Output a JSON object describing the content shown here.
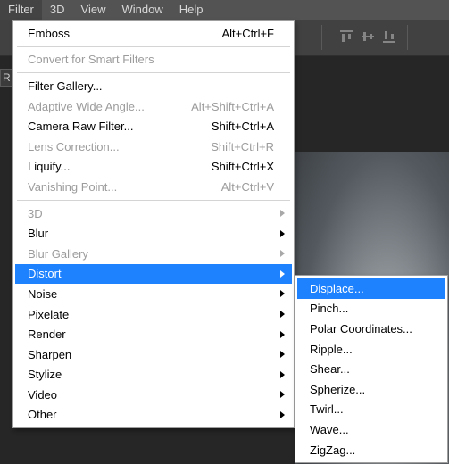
{
  "menubar": {
    "items": [
      "Filter",
      "3D",
      "View",
      "Window",
      "Help"
    ],
    "active_index": 0
  },
  "bg_tab_letter": "R",
  "filter_menu": {
    "last_used": {
      "label": "Emboss",
      "shortcut": "Alt+Ctrl+F"
    },
    "convert": {
      "label": "Convert for Smart Filters"
    },
    "gallery": {
      "label": "Filter Gallery..."
    },
    "adaptive": {
      "label": "Adaptive Wide Angle...",
      "shortcut": "Alt+Shift+Ctrl+A"
    },
    "camera_raw": {
      "label": "Camera Raw Filter...",
      "shortcut": "Shift+Ctrl+A"
    },
    "lens": {
      "label": "Lens Correction...",
      "shortcut": "Shift+Ctrl+R"
    },
    "liquify": {
      "label": "Liquify...",
      "shortcut": "Shift+Ctrl+X"
    },
    "vanishing": {
      "label": "Vanishing Point...",
      "shortcut": "Alt+Ctrl+V"
    },
    "sub3d": {
      "label": "3D"
    },
    "blur": {
      "label": "Blur"
    },
    "blur_gallery": {
      "label": "Blur Gallery"
    },
    "distort": {
      "label": "Distort"
    },
    "noise": {
      "label": "Noise"
    },
    "pixelate": {
      "label": "Pixelate"
    },
    "render": {
      "label": "Render"
    },
    "sharpen": {
      "label": "Sharpen"
    },
    "stylize": {
      "label": "Stylize"
    },
    "video": {
      "label": "Video"
    },
    "other": {
      "label": "Other"
    }
  },
  "distort_submenu": {
    "displace": "Displace...",
    "pinch": "Pinch...",
    "polar": "Polar Coordinates...",
    "ripple": "Ripple...",
    "shear": "Shear...",
    "spherize": "Spherize...",
    "twirl": "Twirl...",
    "wave": "Wave...",
    "zigzag": "ZigZag..."
  }
}
